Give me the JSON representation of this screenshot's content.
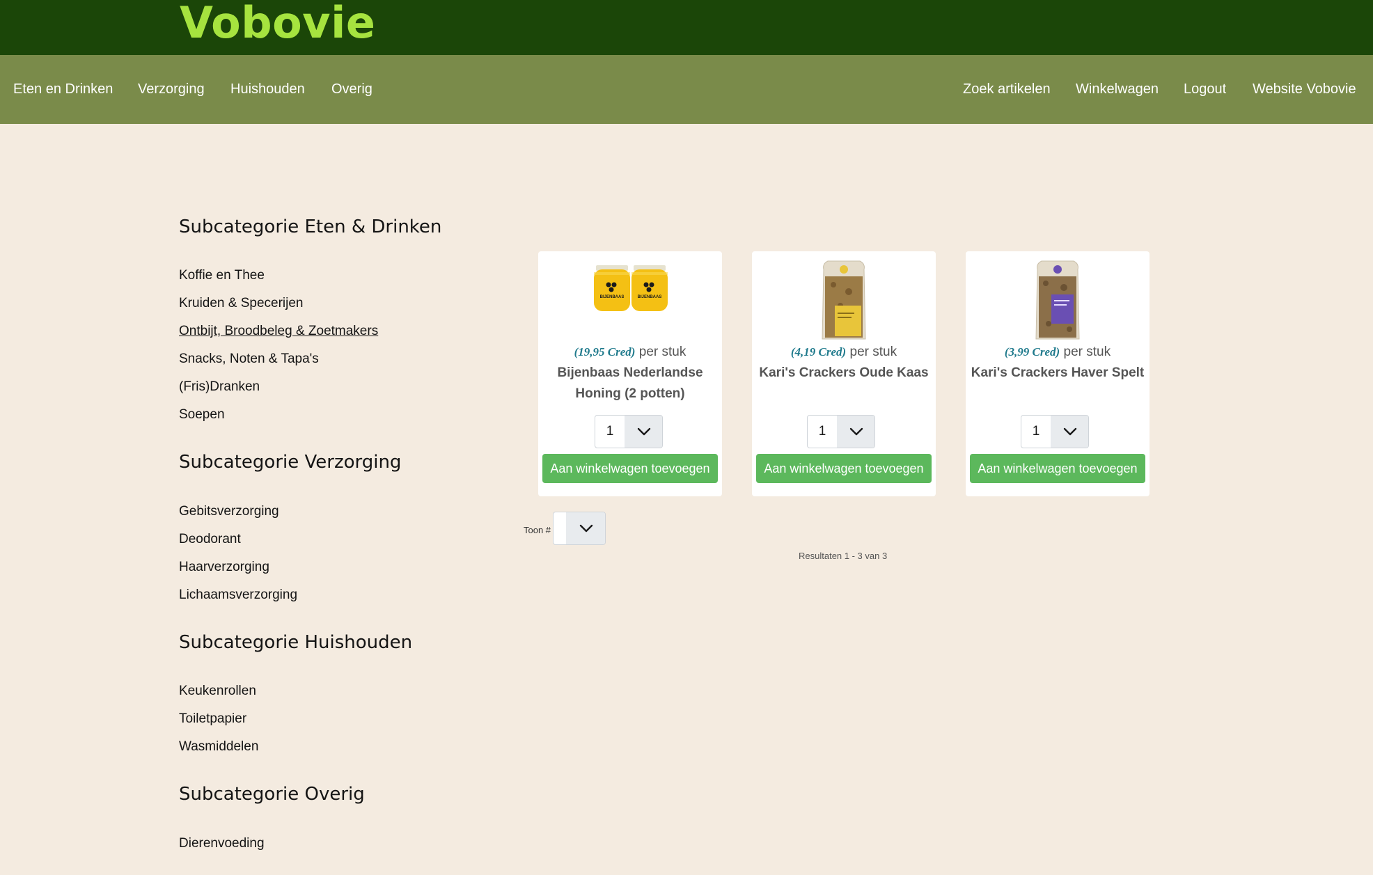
{
  "header": {
    "logo": "Vobovie"
  },
  "nav": {
    "left": [
      "Eten en Drinken",
      "Verzorging",
      "Huishouden",
      "Overig"
    ],
    "right": [
      "Zoek artikelen",
      "Winkelwagen",
      "Logout",
      "Website Vobovie"
    ]
  },
  "sidebar": {
    "sections": [
      {
        "heading": "Subcategorie Eten & Drinken",
        "items": [
          "Koffie en Thee",
          "Kruiden & Specerijen",
          "Ontbijt, Broodbeleg & Zoetmakers",
          "Snacks, Noten & Tapa's",
          "(Fris)Dranken",
          "Soepen"
        ]
      },
      {
        "heading": "Subcategorie Verzorging",
        "items": [
          "Gebitsverzorging",
          "Deodorant",
          "Haarverzorging",
          "Lichaamsverzorging"
        ]
      },
      {
        "heading": "Subcategorie Huishouden",
        "items": [
          "Keukenrollen",
          "Toiletpapier",
          "Wasmiddelen"
        ]
      },
      {
        "heading": "Subcategorie Overig",
        "items": [
          "Dierenvoeding"
        ]
      }
    ]
  },
  "products": [
    {
      "price": "(19,95 Cred)",
      "unit": "per stuk",
      "name": "Bijenbaas Nederlandse Honing (2 potten)",
      "qty": "1",
      "add_label": "Aan winkelwagen toevoegen",
      "jar_label": "BIJENBAAS"
    },
    {
      "price": "(4,19 Cred)",
      "unit": "per stuk",
      "name": "Kari's Crackers Oude Kaas",
      "qty": "1",
      "add_label": "Aan winkelwagen toevoegen"
    },
    {
      "price": "(3,99 Cred)",
      "unit": "per stuk",
      "name": "Kari's Crackers Haver Spelt",
      "qty": "1",
      "add_label": "Aan winkelwagen toevoegen"
    }
  ],
  "pagination": {
    "toon_label": "Toon #",
    "toon_value": "",
    "results": "Resultaten 1 - 3 van 3"
  },
  "colors": {
    "header_bg": "#1b4608",
    "logo": "#a6e33f",
    "nav_bg": "#7a8b4a",
    "page_bg": "#f4ebe0",
    "button": "#5cb85c",
    "price": "#1f7a8c"
  }
}
